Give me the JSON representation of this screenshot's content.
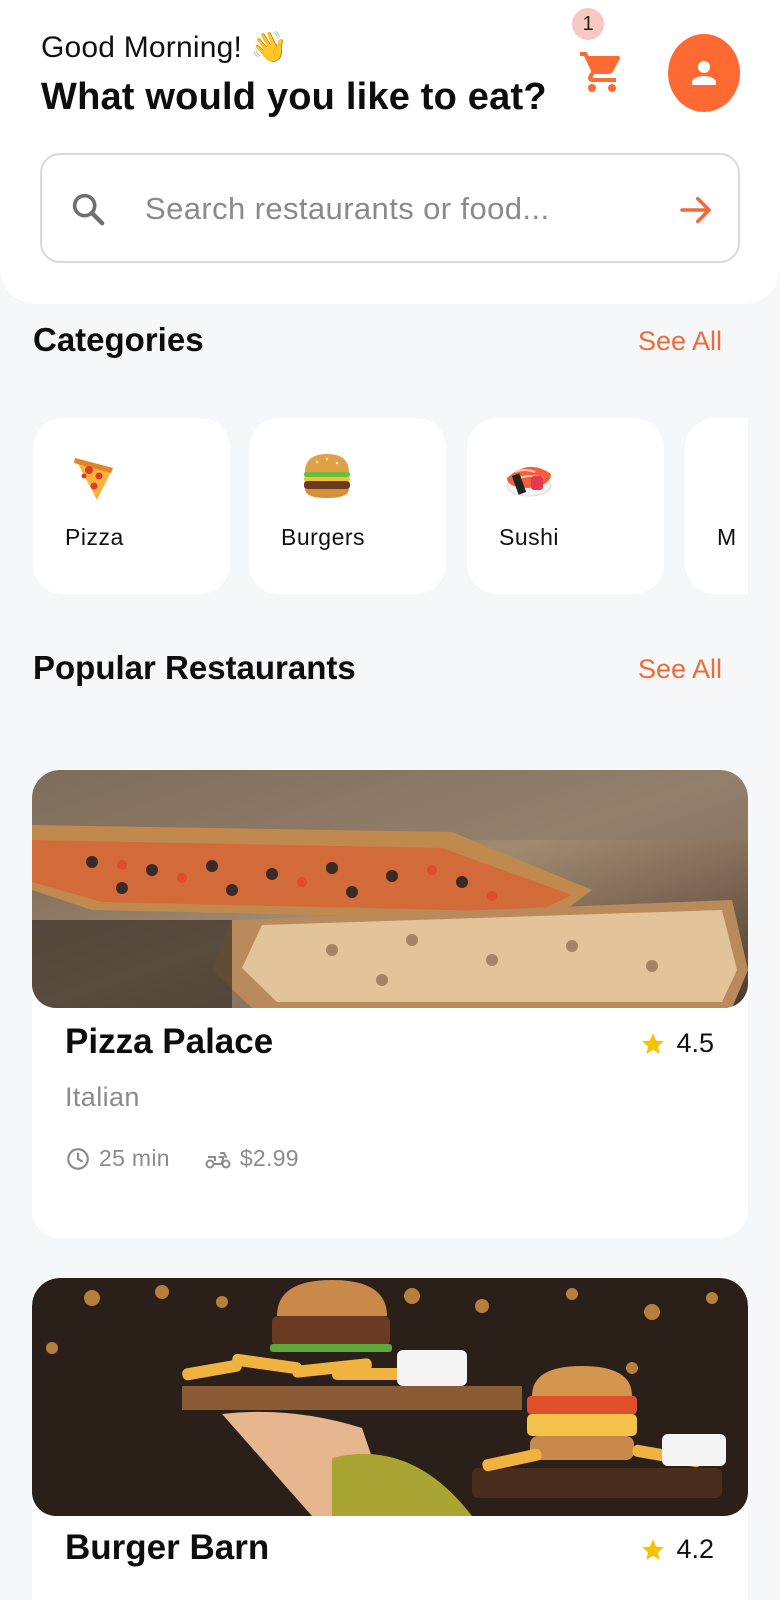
{
  "header": {
    "greeting": "Good Morning! 👋",
    "headline": "What would you like to eat?",
    "cart_count": "1",
    "search_placeholder": "Search restaurants or food..."
  },
  "colors": {
    "accent": "#ff6a33",
    "link": "#ef6a3a",
    "star": "#f5c400",
    "background": "#f6f7f9"
  },
  "categories": {
    "title": "Categories",
    "see_all": "See All",
    "items": [
      {
        "label": "Pizza",
        "icon": "pizza-icon"
      },
      {
        "label": "Burgers",
        "icon": "burger-icon"
      },
      {
        "label": "Sushi",
        "icon": "sushi-icon"
      },
      {
        "label": "M",
        "icon": ""
      }
    ]
  },
  "restaurants": {
    "title": "Popular Restaurants",
    "see_all": "See All",
    "items": [
      {
        "name": "Pizza Palace",
        "rating": "4.5",
        "cuisine": "Italian",
        "time": "25 min",
        "delivery_fee": "$2.99"
      },
      {
        "name": "Burger Barn",
        "rating": "4.2"
      }
    ]
  }
}
